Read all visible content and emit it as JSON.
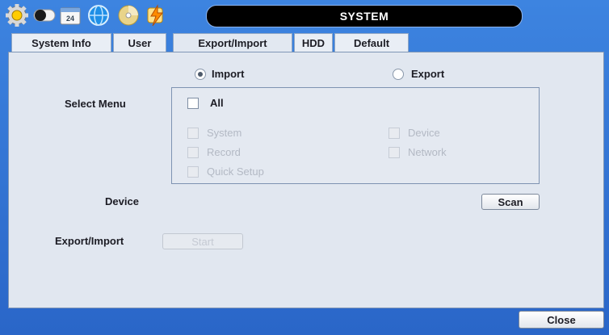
{
  "window": {
    "title": "SYSTEM"
  },
  "tabs": [
    {
      "label": "System Info"
    },
    {
      "label": "User"
    },
    {
      "label": "Export/Import"
    },
    {
      "label": "HDD"
    },
    {
      "label": "Default"
    }
  ],
  "mode": {
    "import_label": "Import",
    "export_label": "Export",
    "selected": "Import"
  },
  "select_menu": {
    "label": "Select Menu",
    "all_label": "All",
    "items": [
      {
        "label": "System"
      },
      {
        "label": "Device"
      },
      {
        "label": "Record"
      },
      {
        "label": "Network"
      },
      {
        "label": "Quick Setup"
      }
    ]
  },
  "device": {
    "label": "Device",
    "scan_label": "Scan"
  },
  "export_import": {
    "label": "Export/Import",
    "start_label": "Start"
  },
  "footer": {
    "close_label": "Close"
  },
  "colors": {
    "background": "#2a66c8",
    "panel": "#e1e7f0",
    "title_bar": "#000000"
  },
  "icons": [
    "gear-icon",
    "toggle-icon",
    "calendar-icon",
    "globe-icon",
    "disc-icon",
    "lightning-icon"
  ]
}
